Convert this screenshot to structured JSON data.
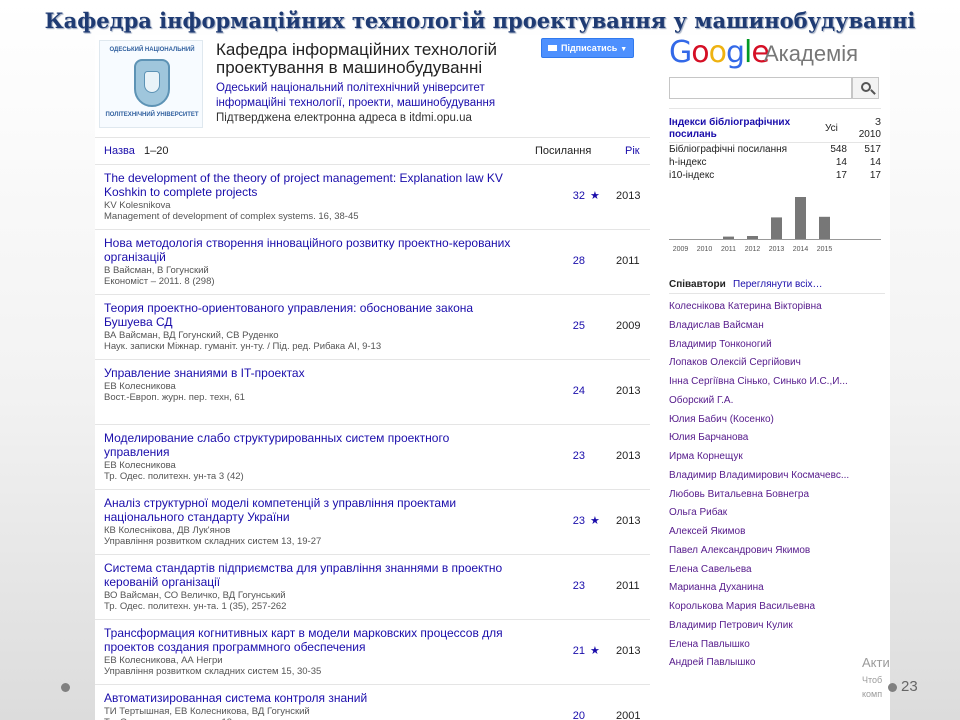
{
  "slide": {
    "title": "Кафедра інформаційних технологій проектування у машинобудуванні",
    "page_number": "23",
    "activation_overlay": [
      "Акти",
      "Чтоб",
      "комп"
    ]
  },
  "profile": {
    "logo_top": "ОДЕСЬКИЙ НАЦІОНАЛЬНИЙ",
    "logo_bottom": "ПОЛІТЕХНІЧНИЙ УНІВЕРСИТЕТ",
    "name_line1": "Кафедра інформаційних технологій",
    "name_line2": "проектування в машинобудуванні",
    "affiliation": "Одеський національний політехнічний університет",
    "interests": "інформаційні технології, проекти, машинобудування",
    "email_verified": "Підтверджена електронна адреса в itdmi.opu.ua",
    "follow_label": "Підписатись"
  },
  "table": {
    "title_header": "Назва",
    "range": "1–20",
    "cited_header": "Посилання",
    "year_header": "Рік"
  },
  "articles": [
    {
      "title": "The development of the theory of project management: Explanation law KV Koshkin to complete projects",
      "authors": "KV Kolesnikova",
      "pub": "Management of development of complex systems. 16, 38-45",
      "cited": "32",
      "star": "★",
      "year": "2013"
    },
    {
      "title": "Нова методологія створення інноваційного розвитку проектно-керованих організацій",
      "authors": "В Вайсман, В Гогунский",
      "pub": "Економіст – 2011. 8 (298)",
      "cited": "28",
      "star": "",
      "year": "2011"
    },
    {
      "title": "Теория проектно-ориентованого управления: обоснование закона Бушуева СД",
      "authors": "ВА Вайсман, ВД Гогунский, СВ Руденко",
      "pub": "Наук. записки Міжнар. гуманіт. ун-ту. / Під. ред. Рибака АІ, 9-13",
      "cited": "25",
      "star": "",
      "year": "2009"
    },
    {
      "title": "Управление знаниями в IT-проектах",
      "authors": "ЕВ Колесникова",
      "pub": "Вост.-Европ. журн. пер. техн, 61",
      "cited": "24",
      "star": "",
      "year": "2013"
    },
    {
      "title": "Моделирование слабо структурированных систем проектного управления",
      "authors": "ЕВ Колесникова",
      "pub": "Тр. Одес. политехн. ун-та 3 (42)",
      "cited": "23",
      "star": "",
      "year": "2013"
    },
    {
      "title": "Аналіз структурної моделі компетенцій з управління проектами національного стандарту України",
      "authors": "КВ Колеснікова, ДВ Лук'янов",
      "pub": "Управління розвитком складних систем 13, 19-27",
      "cited": "23",
      "star": "★",
      "year": "2013"
    },
    {
      "title": "Система стандартів підприємства для управління знаннями в проектно керованій організації",
      "authors": "ВО Вайсман, СО Величко, ВД Гогунський",
      "pub": "Тр. Одес. политехн. ун-та. 1 (35), 257-262",
      "cited": "23",
      "star": "",
      "year": "2011"
    },
    {
      "title": "Трансформация когнитивных карт в модели марковских процессов для проектов создания программного обеспечения",
      "authors": "ЕВ Колесникова, АА Негри",
      "pub": "Управління розвитком складних систем 15, 30-35",
      "cited": "21",
      "star": "★",
      "year": "2013"
    },
    {
      "title": "Автоматизированная система контроля знаний",
      "authors": "ТИ Тертышная, ЕВ Колесникова, ВД Гогунский",
      "pub": "Тр. Одес. политехн. ун-та, 13",
      "cited": "20",
      "star": "",
      "year": "2001"
    }
  ],
  "scholar": {
    "logo_letters": [
      "G",
      "o",
      "o",
      "g",
      "l",
      "e"
    ],
    "logo_colors": [
      "#3369e8",
      "#d50f25",
      "#eeb211",
      "#3369e8",
      "#009925",
      "#d50f25"
    ],
    "product": "Академія",
    "search_placeholder": "",
    "stats_header": "Індекси бібліографічних посилань",
    "col_all": "Усі",
    "col_since": "З 2010",
    "stats": [
      {
        "label": "Бібліографічні посилання",
        "all": "548",
        "since": "517"
      },
      {
        "label": "h-індекс",
        "all": "14",
        "since": "14"
      },
      {
        "label": "i10-індекс",
        "all": "17",
        "since": "17"
      }
    ]
  },
  "chart_data": {
    "type": "bar",
    "categories": [
      "2009",
      "2010",
      "2011",
      "2012",
      "2013",
      "2014",
      "2015"
    ],
    "values": [
      0,
      0,
      4,
      5,
      36,
      70,
      37
    ],
    "ylim": [
      0,
      80
    ],
    "color": "#777777"
  },
  "coauthors": {
    "header": "Співавтори",
    "view_all": "Переглянути всіх…",
    "list": [
      "Колеснікова Катерина Вікторівна",
      "Владислав Вайсман",
      "Владимир Тонконогий",
      "Лопаков Олексій Сергійович",
      "Інна Сергіївна Сінько, Синько И.С.,И...",
      "Оборский Г.А.",
      "Юлия Бабич (Косенко)",
      "Юлия Барчанова",
      "Ирма Корнещук",
      "Владимир Владимирович Космачевс...",
      "Любовь Витальевна Бовнегра",
      "Ольга Рибак",
      "Алексей Якимов",
      "Павел Александрович Якимов",
      "Елена Савельева",
      "Марианна Духанина",
      "Королькова Мария Васильевна",
      "Владимир Петрович Кулик",
      "Елена Павлышко",
      "Андрей Павлышко"
    ]
  }
}
